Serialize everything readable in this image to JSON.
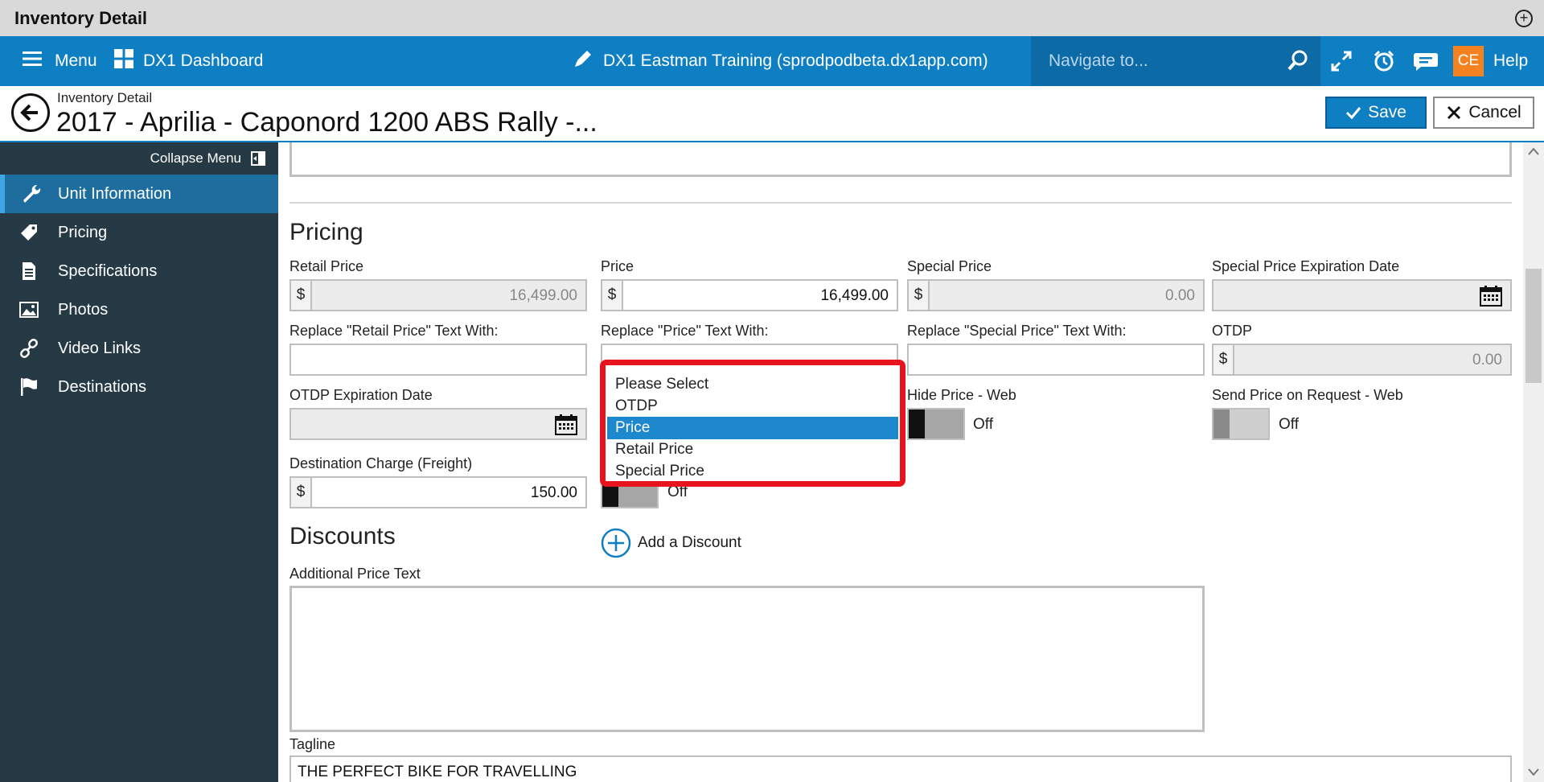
{
  "window": {
    "title": "Inventory Detail"
  },
  "topnav": {
    "menu_label": "Menu",
    "dashboard_label": "DX1 Dashboard",
    "site_label": "DX1 Eastman Training (sprodpodbeta.dx1app.com)",
    "search_placeholder": "Navigate to...",
    "user_initials": "CE",
    "help_label": "Help"
  },
  "header": {
    "breadcrumb": "Inventory Detail",
    "title": "2017 - Aprilia - Caponord 1200 ABS Rally -...",
    "save_label": "Save",
    "cancel_label": "Cancel"
  },
  "sidebar": {
    "collapse_label": "Collapse Menu",
    "items": [
      {
        "label": "Unit Information",
        "icon": "wrench-icon",
        "active": true
      },
      {
        "label": "Pricing",
        "icon": "tag-icon",
        "active": false
      },
      {
        "label": "Specifications",
        "icon": "document-icon",
        "active": false
      },
      {
        "label": "Photos",
        "icon": "image-icon",
        "active": false
      },
      {
        "label": "Video Links",
        "icon": "link-icon",
        "active": false
      },
      {
        "label": "Destinations",
        "icon": "flag-icon",
        "active": false
      }
    ]
  },
  "pricing": {
    "section_title": "Pricing",
    "retail_price": {
      "label": "Retail Price",
      "prefix": "$",
      "value": "16,499.00"
    },
    "price": {
      "label": "Price",
      "prefix": "$",
      "value": "16,499.00"
    },
    "special_price": {
      "label": "Special Price",
      "prefix": "$",
      "value": "0.00"
    },
    "special_price_expiration": {
      "label": "Special Price Expiration Date"
    },
    "replace_retail": {
      "label": "Replace \"Retail Price\" Text With:"
    },
    "replace_price": {
      "label": "Replace \"Price\" Text With:"
    },
    "replace_special": {
      "label": "Replace \"Special Price\" Text With:"
    },
    "otdp": {
      "label": "OTDP",
      "prefix": "$",
      "value": "0.00"
    },
    "otdp_expiration": {
      "label": "OTDP Expiration Date"
    },
    "hide_price_web": {
      "label": "Hide Price - Web",
      "state": "Off"
    },
    "send_price_on_request": {
      "label": "Send Price on Request - Web",
      "state": "Off"
    },
    "destination_charge": {
      "label": "Destination Charge (Freight)",
      "prefix": "$",
      "value": "150.00"
    },
    "hidden_toggle": {
      "state": "Off"
    }
  },
  "dropdown": {
    "options": [
      "Please Select",
      "OTDP",
      "Price",
      "Retail Price",
      "Special Price"
    ],
    "selected": "Price"
  },
  "discounts": {
    "section_title": "Discounts",
    "add_label": "Add a Discount",
    "additional_price_text_label": "Additional Price Text",
    "tagline_label": "Tagline",
    "tagline_value": "THE PERFECT BIKE FOR TRAVELLING"
  },
  "colors": {
    "nav_blue": "#0f7fc4",
    "sidebar": "#263a45",
    "highlight_red": "#e8141b",
    "badge_orange": "#f58220"
  }
}
